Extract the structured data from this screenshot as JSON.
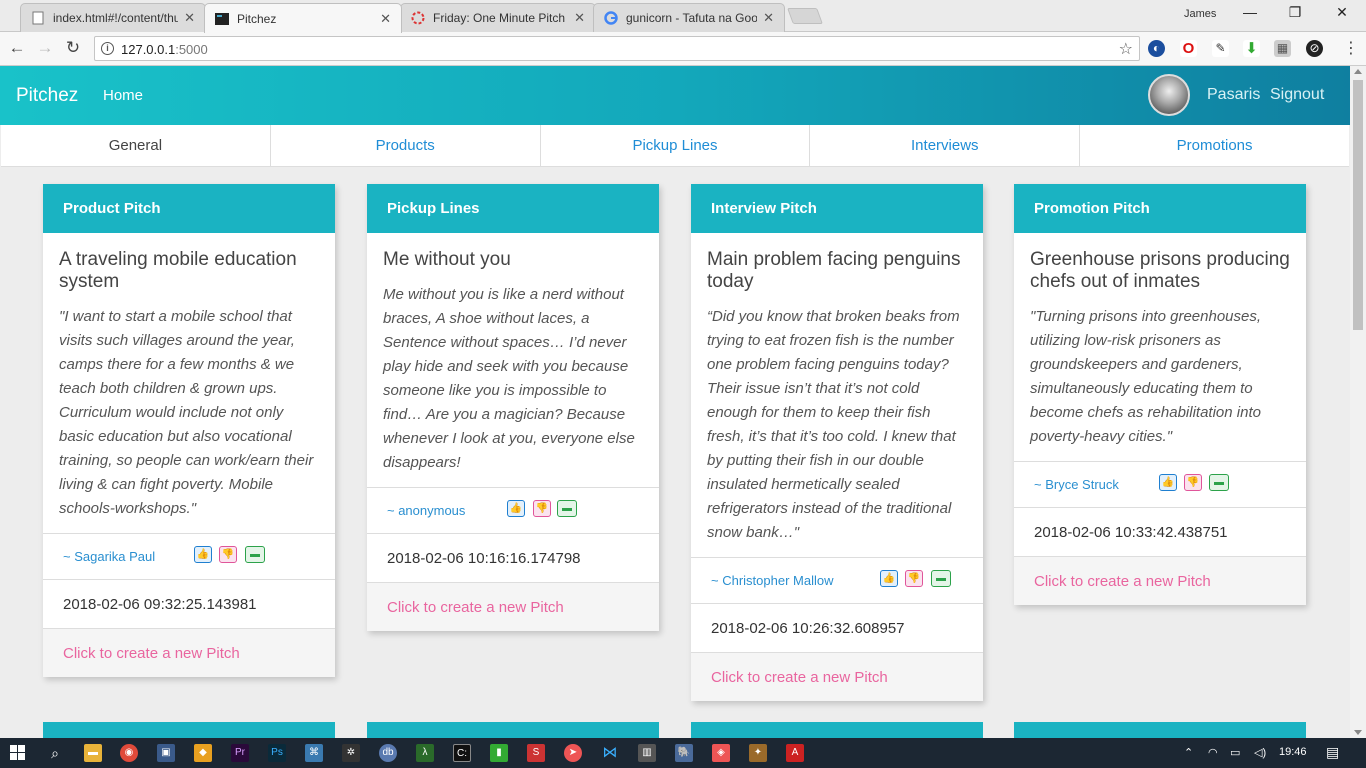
{
  "browser": {
    "tabs": [
      {
        "title": "index.html#!/content/thu",
        "active": false
      },
      {
        "title": "Pitchez",
        "active": true
      },
      {
        "title": "Friday: One Minute Pitch",
        "active": false
      },
      {
        "title": "gunicorn - Tafuta na Goo",
        "active": false
      }
    ],
    "user": "James",
    "url_host": "127.0.0.1",
    "url_port": ":5000"
  },
  "navbar": {
    "brand": "Pitchez",
    "home": "Home",
    "username": "Pasaris",
    "signout": "Signout"
  },
  "categories": [
    "General",
    "Products",
    "Pickup Lines",
    "Interviews",
    "Promotions"
  ],
  "cards": [
    {
      "header": "Product Pitch",
      "title": "A traveling mobile education system",
      "text": "\"I want to start a mobile school that visits such villages around the year, camps there for a few months & we teach both children & grown ups. Curriculum would include not only basic education but also vocational training, so people can work/earn their living & can fight poverty. Mobile schools-workshops.\"",
      "author": "~ Sagarika Paul",
      "date": "2018-02-06 09:32:25.143981",
      "cta": "Click to create a new Pitch"
    },
    {
      "header": "Pickup Lines",
      "title": "Me without you",
      "text": "Me without you is like a nerd without braces, A shoe without laces, a Sentence without spaces… I’d never play hide and seek with you because someone like you is impossible to find… Are you a magician? Because whenever I look at you, everyone else disappears!",
      "author": "~ anonymous",
      "date": "2018-02-06 10:16:16.174798",
      "cta": "Click to create a new Pitch"
    },
    {
      "header": "Interview Pitch",
      "title": "Main problem facing penguins today",
      "text": "“Did you know that broken beaks from trying to eat frozen fish is the number one problem facing penguins today? Their issue isn’t that it’s not cold enough for them to keep their fish fresh, it’s that it’s too cold. I knew that by putting their fish in our double insulated hermetically sealed refrigerators instead of the traditional snow bank…\"",
      "author": "~ Christopher Mallow",
      "date": "2018-02-06 10:26:32.608957",
      "cta": "Click to create a new Pitch"
    },
    {
      "header": "Promotion Pitch",
      "title": "Greenhouse prisons producing chefs out of inmates",
      "text": "\"Turning prisons into greenhouses, utilizing low-risk prisoners as groundskeepers and gardeners, simultaneously educating them to become chefs as rehabilitation into poverty-heavy cities.\"",
      "author": "~ Bryce Struck",
      "date": "2018-02-06 10:33:42.438751",
      "cta": "Click to create a new Pitch"
    }
  ],
  "taskbar": {
    "time": "19:46"
  },
  "colors": {
    "navbar_start": "#19c2c9",
    "navbar_end": "#0f7fa0",
    "card_header": "#1ab3c2",
    "link_blue": "#1f8dd6",
    "cta_pink": "#e9659f"
  }
}
